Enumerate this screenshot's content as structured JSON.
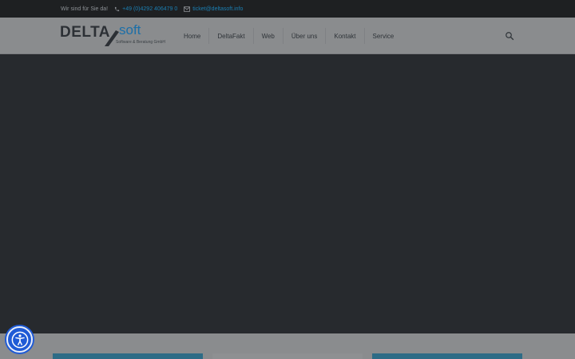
{
  "topbar": {
    "greeting": "Wir sind für Sie da!",
    "phone": "+49 (0)4292 406479 0",
    "email": "ticket@deltasoft.info"
  },
  "logo": {
    "word1": "DELTA",
    "word2": "soft",
    "tagline": "Software & Beratung GmbH"
  },
  "nav": {
    "items": [
      "Home",
      "DeltaFakt",
      "Web",
      "Über uns",
      "Kontakt",
      "Service"
    ]
  },
  "icons": {
    "phone": "phone-icon",
    "email": "envelope-icon",
    "search": "search-icon",
    "accessibility": "accessibility-icon"
  },
  "colors": {
    "topbar_bg": "#1e2022",
    "header_bg": "#8a8c8e",
    "hero_bg": "#272a2e",
    "link_blue": "#1b7fb3",
    "card_teal": "#2e6c86",
    "a11y_blue": "#1f5bd6"
  }
}
